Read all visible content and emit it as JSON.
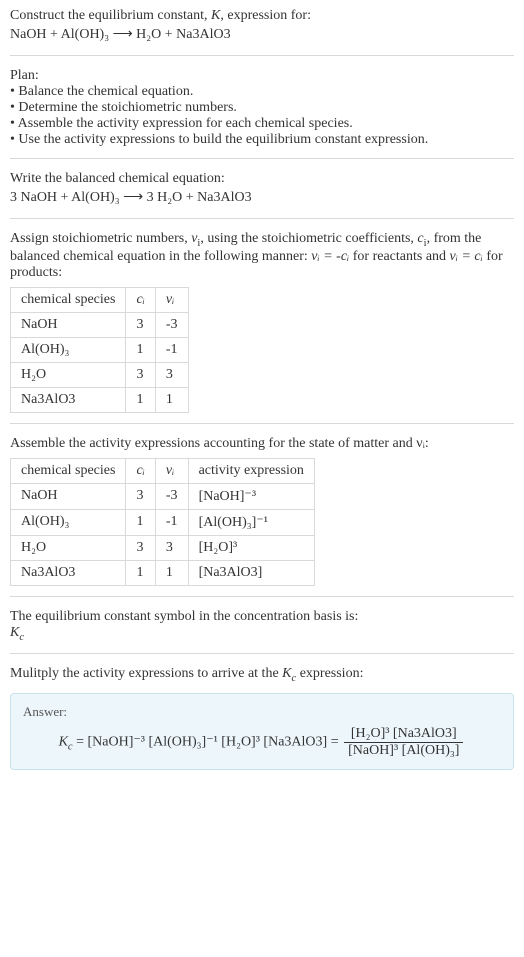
{
  "prompt": {
    "line1_pre": "Construct the equilibrium constant, ",
    "line1_K": "K",
    "line1_post": ", expression for:",
    "equation": "NaOH + Al(OH)₃  ⟶  H₂O + Na3AlO3"
  },
  "plan": {
    "heading": "Plan:",
    "items": [
      "Balance the chemical equation.",
      "Determine the stoichiometric numbers.",
      "Assemble the activity expression for each chemical species.",
      "Use the activity expressions to build the equilibrium constant expression."
    ]
  },
  "balanced": {
    "heading": "Write the balanced chemical equation:",
    "equation": "3 NaOH + Al(OH)₃  ⟶  3 H₂O + Na3AlO3"
  },
  "stoich": {
    "para_pre": "Assign stoichiometric numbers, ",
    "nu": "ν",
    "sub_i": "i",
    "para_mid1": ", using the stoichiometric coefficients, ",
    "c": "c",
    "para_mid2": ", from the balanced chemical equation in the following manner: ",
    "rel_reac": "νᵢ = -cᵢ",
    "para_mid3": " for reactants and ",
    "rel_prod": "νᵢ = cᵢ",
    "para_mid4": " for products:",
    "headers": [
      "chemical species",
      "cᵢ",
      "νᵢ"
    ],
    "rows": [
      [
        "NaOH",
        "3",
        "-3"
      ],
      [
        "Al(OH)₃",
        "1",
        "-1"
      ],
      [
        "H₂O",
        "3",
        "3"
      ],
      [
        "Na3AlO3",
        "1",
        "1"
      ]
    ]
  },
  "activity": {
    "para": "Assemble the activity expressions accounting for the state of matter and νᵢ:",
    "headers": [
      "chemical species",
      "cᵢ",
      "νᵢ",
      "activity expression"
    ],
    "rows": [
      [
        "NaOH",
        "3",
        "-3",
        "[NaOH]⁻³"
      ],
      [
        "Al(OH)₃",
        "1",
        "-1",
        "[Al(OH)₃]⁻¹"
      ],
      [
        "H₂O",
        "3",
        "3",
        "[H₂O]³"
      ],
      [
        "Na3AlO3",
        "1",
        "1",
        "[Na3AlO3]"
      ]
    ]
  },
  "symbol": {
    "line1": "The equilibrium constant symbol in the concentration basis is:",
    "kc": "K",
    "sub": "c"
  },
  "multiply": {
    "line": "Mulitply the activity expressions to arrive at the ",
    "kc": "K",
    "sub": "c",
    "post": " expression:"
  },
  "answer": {
    "label": "Answer:",
    "lhs": "K",
    "lhs_sub": "c",
    "eq": " = ",
    "flat": "[NaOH]⁻³ [Al(OH)₃]⁻¹ [H₂O]³ [Na3AlO3]",
    "eq2": " = ",
    "frac_num": "[H₂O]³ [Na3AlO3]",
    "frac_den": "[NaOH]³ [Al(OH)₃]"
  }
}
